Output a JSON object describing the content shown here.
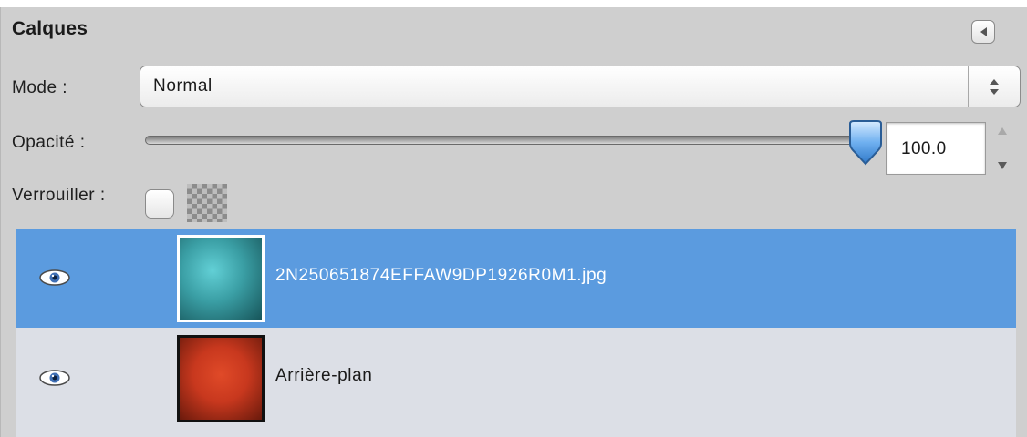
{
  "panel": {
    "title": "Calques",
    "collapse_icon": "collapse-left-icon"
  },
  "mode": {
    "label": "Mode :",
    "value": "Normal"
  },
  "opacity": {
    "label": "Opacité :",
    "value": "100.0",
    "percent": 100
  },
  "lock": {
    "label": "Verrouiller :"
  },
  "layers": [
    {
      "name": "2N250651874EFFAW9DP1926R0M1.jpg",
      "selected": true,
      "visible": true,
      "thumb_color": "#3a9ea4"
    },
    {
      "name": "Arrière-plan",
      "selected": false,
      "visible": true,
      "thumb_color": "#c8381e"
    }
  ],
  "colors": {
    "selection": "#5b9bdf",
    "panel_bg": "#cfcfcf"
  }
}
